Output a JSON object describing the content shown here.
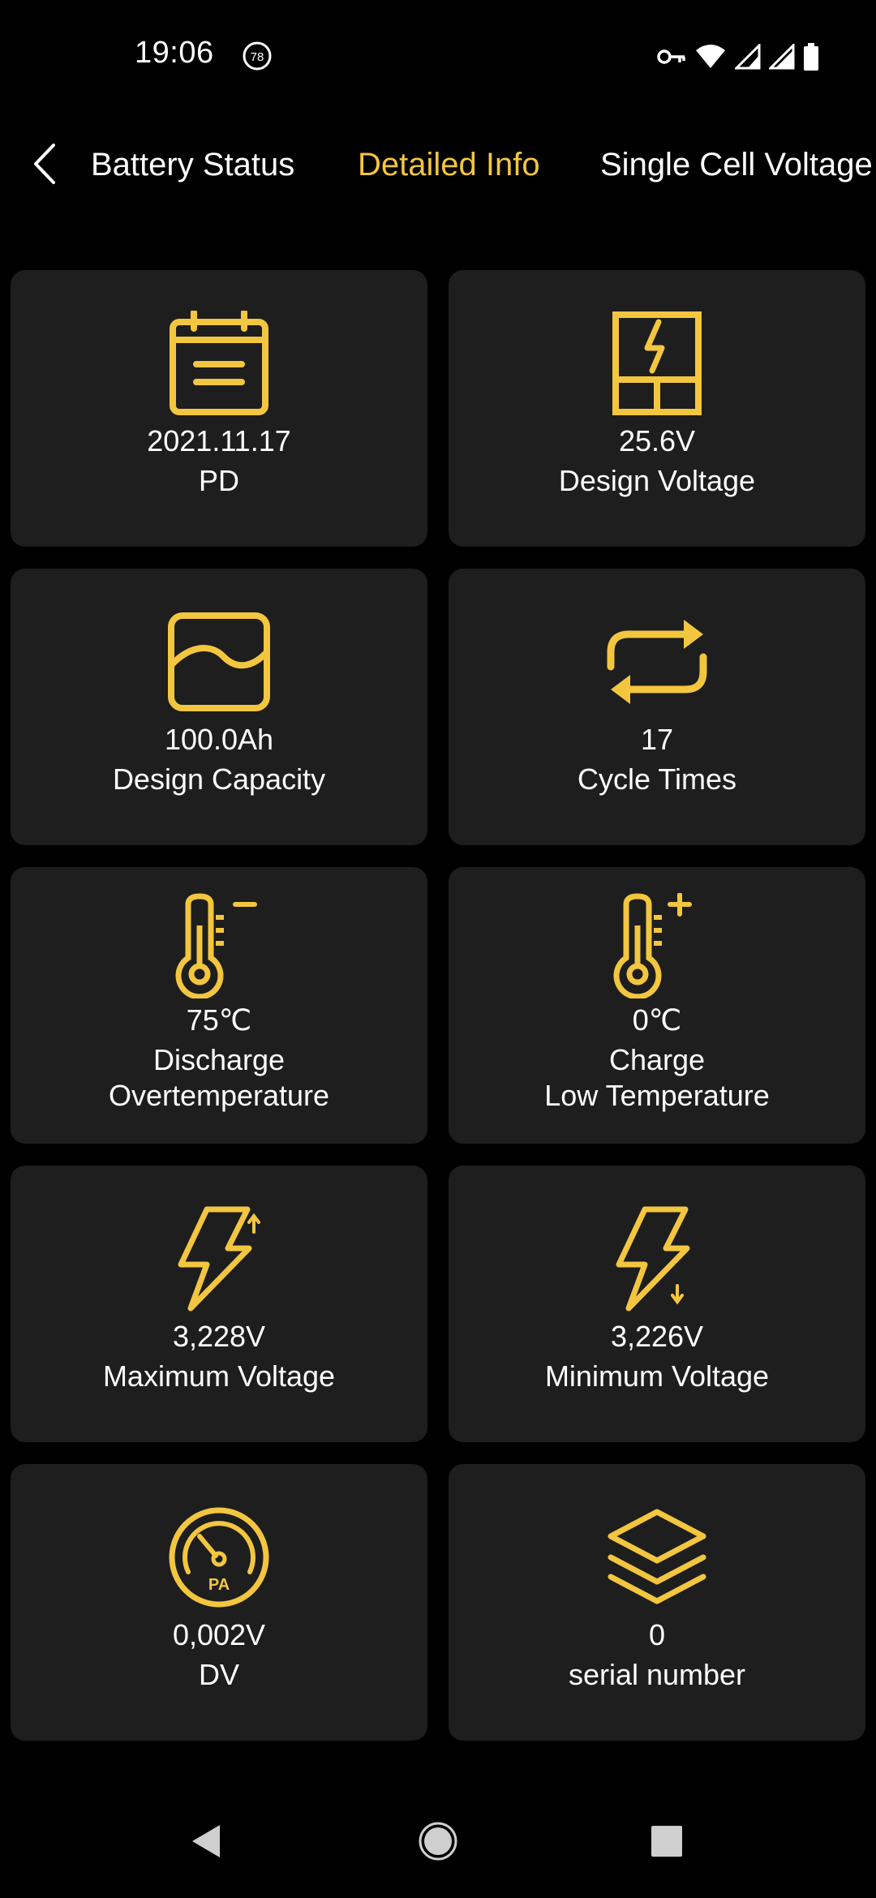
{
  "status_bar": {
    "time": "19:06",
    "notification_badge": "78",
    "icons": [
      "vpn-key-icon",
      "wifi-icon",
      "signal-icon",
      "signal-icon",
      "battery-icon"
    ]
  },
  "tabs": [
    {
      "label": "Battery Status",
      "active": false
    },
    {
      "label": "Detailed Info",
      "active": true
    },
    {
      "label": "Single Cell Voltage",
      "active": false
    }
  ],
  "colors": {
    "accent": "#F3C63F",
    "card_bg": "#1e1e1e",
    "background": "#000000",
    "text": "#ffffff"
  },
  "cards": [
    {
      "icon": "calendar-icon",
      "value": "2021.11.17",
      "label": "PD"
    },
    {
      "icon": "design-voltage-icon",
      "value": "25.6V",
      "label": "Design Voltage"
    },
    {
      "icon": "capacity-wave-icon",
      "value": "100.0Ah",
      "label": "Design Capacity"
    },
    {
      "icon": "cycle-arrows-icon",
      "value": "17",
      "label": "Cycle Times"
    },
    {
      "icon": "thermometer-minus-icon",
      "value": "75℃",
      "label": "Discharge\nOvertemperature"
    },
    {
      "icon": "thermometer-plus-icon",
      "value": "0℃",
      "label": "Charge\nLow Temperature"
    },
    {
      "icon": "bolt-up-icon",
      "value": "3,228V",
      "label": "Maximum Voltage"
    },
    {
      "icon": "bolt-down-icon",
      "value": "3,226V",
      "label": "Minimum Voltage"
    },
    {
      "icon": "gauge-icon",
      "value": "0,002V",
      "label": "DV",
      "icon_text": "PA"
    },
    {
      "icon": "layers-icon",
      "value": "0",
      "label": "serial number"
    }
  ],
  "nav_bar": {
    "buttons": [
      "back-triangle-icon",
      "home-circle-icon",
      "recents-square-icon"
    ]
  }
}
